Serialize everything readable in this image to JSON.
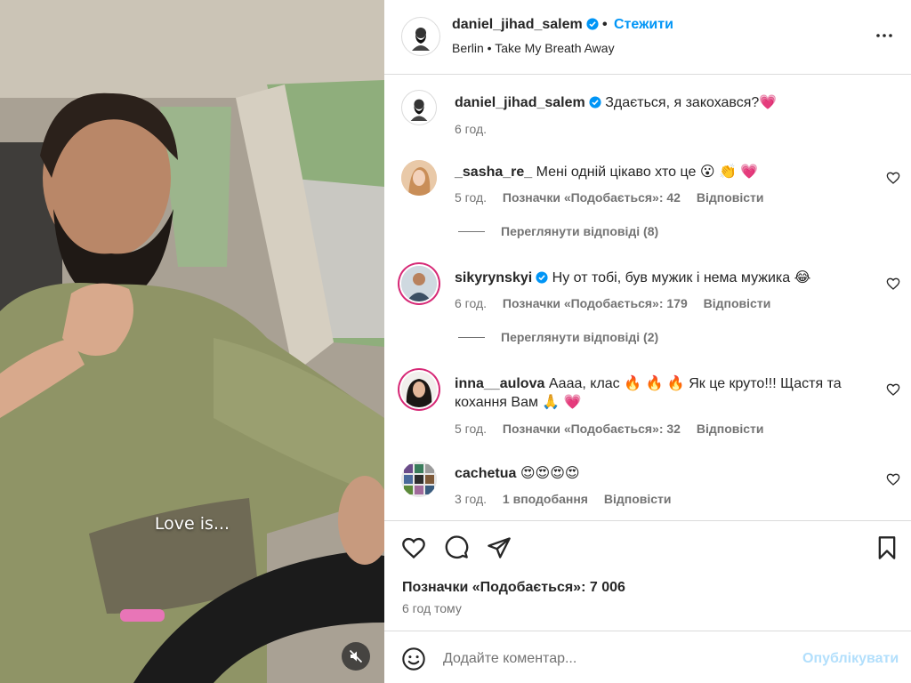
{
  "video": {
    "caption": "Love is...",
    "mute_icon": "speaker-muted-icon"
  },
  "header": {
    "username": "daniel_jihad_salem",
    "separator": "•",
    "follow_label": "Стежити",
    "subline": "Berlin • Take My Breath Away",
    "more_icon": "more-horizontal-icon"
  },
  "caption_comment": {
    "username": "daniel_jihad_salem",
    "text": "Здається, я закохався?💗",
    "time": "6 год."
  },
  "comments": [
    {
      "username": "_sasha_re_",
      "text": "Мені одній цікаво хто це 😮 👏 💗",
      "time": "5 год.",
      "likes": "Позначки «Подобається»: 42",
      "reply": "Відповісти",
      "view_replies": "Переглянути відповіді (8)"
    },
    {
      "username": "sikyrynskyi",
      "text": "Ну от тобі, був мужик і нема мужика 😂",
      "time": "6 год.",
      "likes": "Позначки «Подобається»: 179",
      "reply": "Відповісти",
      "view_replies": "Переглянути відповіді (2)"
    },
    {
      "username": "inna__aulova",
      "text": "Аааа, клас 🔥 🔥 🔥 Як це круто!!! Щастя та кохання Вам 🙏 💗",
      "time": "5 год.",
      "likes": "Позначки «Подобається»: 32",
      "reply": "Відповісти"
    },
    {
      "username": "cachetua",
      "text": "😍😍😍😍",
      "time": "3 год.",
      "likes": "1 вподобання",
      "reply": "Відповісти"
    }
  ],
  "actions": {
    "likes": "Позначки «Подобається»: 7 006",
    "time": "6 год тому"
  },
  "add_comment": {
    "placeholder": "Додайте коментар...",
    "publish_label": "Опублікувати"
  },
  "colors": {
    "accent": "#0095f6",
    "verified": "#0095f6",
    "muted_text": "#737373",
    "publish_disabled": "#b2dffc",
    "story_ring": "#d62976"
  }
}
